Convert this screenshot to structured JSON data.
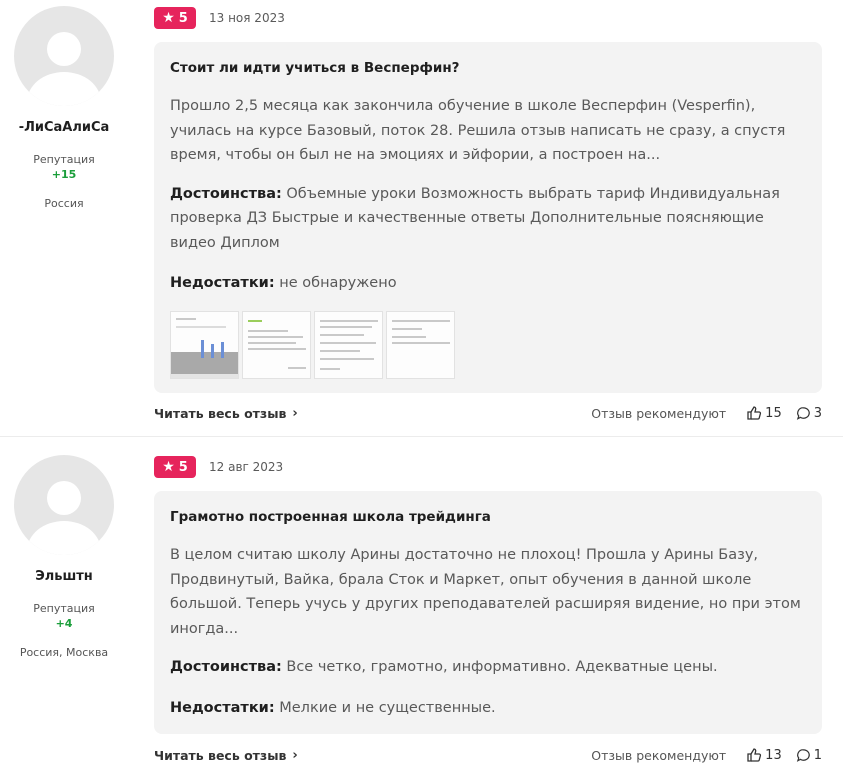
{
  "reviews": [
    {
      "author": {
        "name": "-ЛиСаАлиСа",
        "reputation_label": "Репутация",
        "reputation_value": "+15",
        "location": "Россия"
      },
      "rating": "5",
      "date": "13 ноя 2023",
      "title": "Стоит ли идти учиться в Весперфин?",
      "text": "Прошло 2,5 месяца как закончила обучение в школе Весперфин (Vesperfin), училась на курсе Базовый, поток 28. Решила отзыв написать не сразу, а спустя время, чтобы он был не на эмоциях и эйфории, а построен на...",
      "pros_label": "Достоинства:",
      "pros": "Объемные уроки Возможность выбрать тариф Индивидуальная проверка ДЗ Быстрые и качественные ответы Дополнительные поясняющие видео Диплом",
      "cons_label": "Недостатки:",
      "cons": "не обнаружено",
      "read_more": "Читать весь отзыв",
      "recommend_label": "Отзыв рекомендуют",
      "likes": "15",
      "comments": "3"
    },
    {
      "author": {
        "name": "Эльштн",
        "reputation_label": "Репутация",
        "reputation_value": "+4",
        "location": "Россия, Москва"
      },
      "rating": "5",
      "date": "12 авг 2023",
      "title": "Грамотно построенная школа трейдинга",
      "text": "В целом считаю школу Арины достаточно не плохоц! Прошла у Арины Базу, Продвинутый, Вайка, брала Сток и Маркет, опыт обучения в данной школе большой. Теперь учусь у других преподавателей расширяя видение, но при этом иногда...",
      "pros_label": "Достоинства:",
      "pros": "Все четко, грамотно, информативно. Адекватные цены.",
      "cons_label": "Недостатки:",
      "cons": "Мелкие и не существенные.",
      "read_more": "Читать весь отзыв",
      "recommend_label": "Отзыв рекомендуют",
      "likes": "13",
      "comments": "1"
    }
  ],
  "colors": {
    "badge": "#e6245c",
    "reputation": "#1a9e3a",
    "card": "#f3f3f3"
  },
  "icons": [
    "star-icon",
    "thumbs-up-icon",
    "comment-icon",
    "chevron-right-icon",
    "avatar-placeholder-icon"
  ]
}
